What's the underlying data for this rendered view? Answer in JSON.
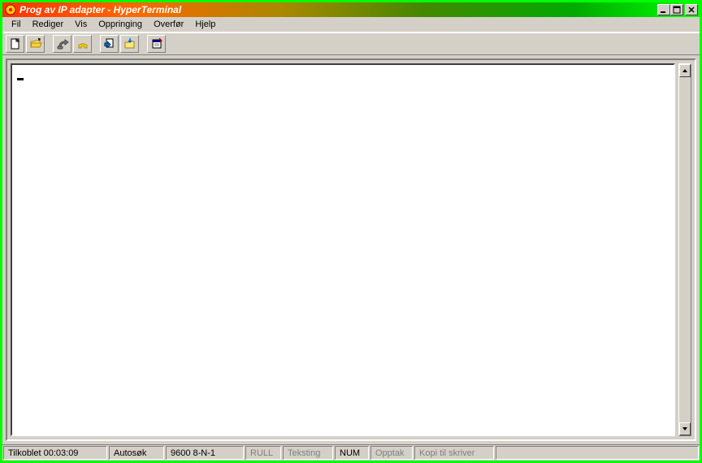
{
  "title": "Prog av IP adapter - HyperTerminal",
  "menu": {
    "fil": "Fil",
    "rediger": "Rediger",
    "vis": "Vis",
    "oppringing": "Oppringing",
    "overfor": "Overfør",
    "hjelp": "Hjelp"
  },
  "toolbar_icons": {
    "new": "new-document-icon",
    "open": "open-folder-icon",
    "connect": "connect-icon",
    "disconnect": "disconnect-phone-icon",
    "send": "send-file-icon",
    "receive": "receive-file-icon",
    "properties": "properties-icon"
  },
  "terminal": {
    "content": ""
  },
  "status": {
    "connection": "Tilkoblet 00:03:09",
    "detect": "Autosøk",
    "settings": "9600 8-N-1",
    "rull": "RULL",
    "teksting": "Teksting",
    "num": "NUM",
    "opptak": "Opptak",
    "print": "Kopi til skriver"
  }
}
